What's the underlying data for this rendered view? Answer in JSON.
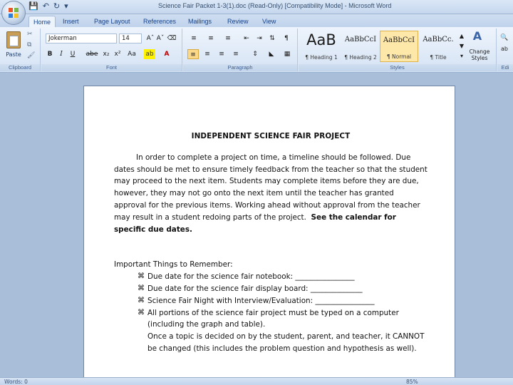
{
  "window": {
    "title": "Science Fair Packet 1-3(1).doc (Read-Only) [Compatibility Mode] - Microsoft Word"
  },
  "quick_access": {
    "save_icon": "save-icon",
    "undo_icon": "undo-icon",
    "redo_icon": "redo-icon"
  },
  "tabs": [
    "Home",
    "Insert",
    "Page Layout",
    "References",
    "Mailings",
    "Review",
    "View"
  ],
  "ribbon": {
    "clipboard": {
      "paste_label": "Paste",
      "group_label": "Clipboard"
    },
    "font": {
      "font_name": "Jokerman",
      "font_size": "14",
      "group_label": "Font",
      "buttons": [
        "B",
        "I",
        "U",
        "abe",
        "x₂",
        "x²",
        "Aa"
      ]
    },
    "paragraph": {
      "group_label": "Paragraph"
    },
    "styles": {
      "group_label": "Styles",
      "tiles": [
        {
          "sample": "AaB",
          "name": "¶ Heading 1"
        },
        {
          "sample": "AaBbCcI",
          "name": "¶ Heading 2"
        },
        {
          "sample": "AaBbCcI",
          "name": "¶ Normal"
        },
        {
          "sample": "AaBbCc.",
          "name": "¶ Title"
        }
      ],
      "change_styles_label": "Change Styles"
    },
    "editing": {
      "group_label": "Edi"
    }
  },
  "document": {
    "title": "INDEPENDENT SCIENCE FAIR PROJECT",
    "paragraph": "In order to complete a project on time, a timeline should be followed. Due dates should be met to ensure timely feedback from the teacher so that the student may proceed to the next item.  Students may complete items before they are due, however, they may not go onto the next item until the teacher has granted approval for the previous items.  Working ahead without approval from the teacher may result in a student redoing parts of the project.",
    "paragraph_bold": "See the calendar for specific due dates.",
    "things_heading": "Important Things to Remember:",
    "bullet_glyph": "⌘",
    "bullets": [
      "Due date for the science fair notebook: ________________",
      "Due date for the science fair display board: ______________",
      "Science Fair Night with Interview/Evaluation: ________________",
      "All portions of the science fair project must be typed on a computer (including the graph and table)."
    ],
    "continuation": "Once a topic is decided on by the student, parent, and teacher, it CANNOT be changed (this includes the problem question and hypothesis as well)."
  },
  "status": {
    "words_label": "Words: 0",
    "zoom": "85%"
  }
}
